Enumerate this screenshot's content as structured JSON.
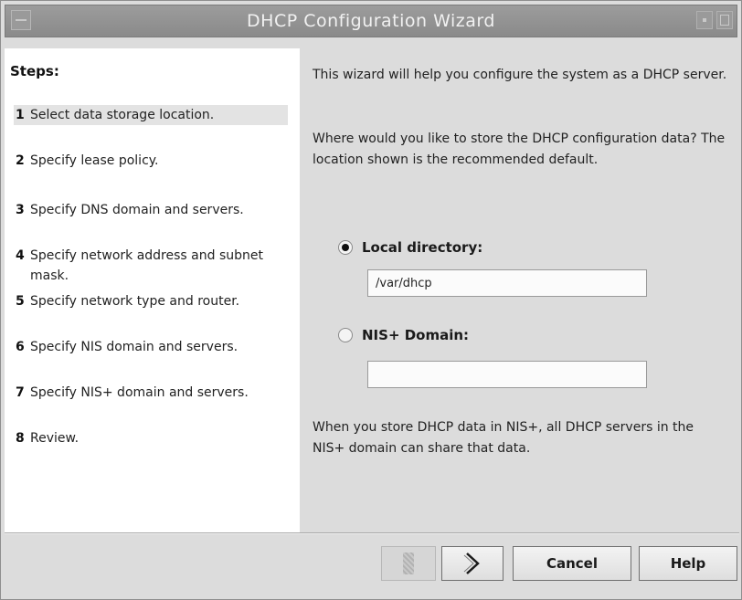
{
  "window": {
    "title": "DHCP Configuration Wizard"
  },
  "steps": {
    "heading": "Steps:",
    "items": [
      {
        "num": "1",
        "label": "Select data storage location.",
        "active": true
      },
      {
        "num": "2",
        "label": "Specify lease policy."
      },
      {
        "num": "3",
        "label": "Specify DNS domain and servers."
      },
      {
        "num": "4",
        "label": "Specify network address and subnet mask."
      },
      {
        "num": "5",
        "label": "Specify network type and router."
      },
      {
        "num": "6",
        "label": "Specify NIS domain and servers."
      },
      {
        "num": "7",
        "label": "Specify NIS+ domain and servers."
      },
      {
        "num": "8",
        "label": "Review."
      }
    ]
  },
  "content": {
    "intro": "This wizard will help you configure the system as a DHCP server.",
    "question": "Where would you like to store the DHCP configuration data?  The location shown is the recommended default.",
    "options": {
      "local": {
        "label": "Local directory:",
        "selected": true,
        "value": "/var/dhcp"
      },
      "nis": {
        "label": "NIS+ Domain:",
        "selected": false,
        "value": ""
      }
    },
    "note": "When you store DHCP data in NIS+, all DHCP servers in the NIS+ domain can share that data."
  },
  "buttons": {
    "back_icon": "back-arrow-disabled",
    "next_icon": "chevron-right-icon",
    "cancel": "Cancel",
    "help": "Help"
  }
}
